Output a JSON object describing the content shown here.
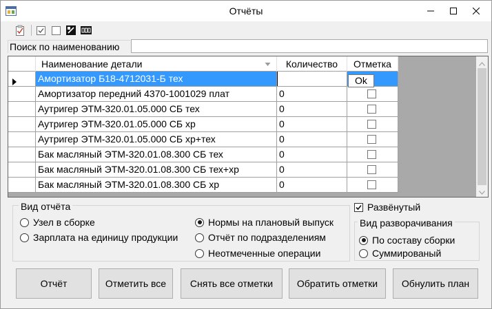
{
  "window": {
    "title": "Отчёты"
  },
  "search": {
    "label": "Поиск по наименованию",
    "value": ""
  },
  "grid": {
    "columns": [
      "Наименование детали",
      "Количество",
      "Отметка"
    ],
    "rows": [
      {
        "name": "Амортизатор Б18-4712031-Б тех",
        "qty": "",
        "checked": false,
        "selected": true
      },
      {
        "name": "Амортизатор передний 4370-1001029 плат",
        "qty": "0",
        "checked": false,
        "selected": false
      },
      {
        "name": "Аутригер ЭТМ-320.01.05.000 СБ тех",
        "qty": "0",
        "checked": false,
        "selected": false
      },
      {
        "name": "Аутригер ЭТМ-320.01.05.000 СБ хр",
        "qty": "0",
        "checked": false,
        "selected": false
      },
      {
        "name": "Аутригер ЭТМ-320.01.05.000 СБ хр+тех",
        "qty": "0",
        "checked": false,
        "selected": false
      },
      {
        "name": "Бак масляный ЭТМ-320.01.08.300 СБ тех",
        "qty": "0",
        "checked": false,
        "selected": false
      },
      {
        "name": "Бак масляный ЭТМ-320.01.08.300 СБ тех+хр",
        "qty": "0",
        "checked": false,
        "selected": false
      },
      {
        "name": "Бак масляный ЭТМ-320.01.08.300 СБ хр",
        "qty": "0",
        "checked": false,
        "selected": false
      }
    ],
    "ok_popup": "Ok"
  },
  "report_type": {
    "label": "Вид отчёта",
    "options": [
      "Узел в сборке",
      "Зарплата на единицу продукции",
      "Нормы на плановый выпуск",
      "Отчёт по подразделениям",
      "Неотмеченные операции"
    ],
    "selected": "Нормы на плановый выпуск"
  },
  "expanded": {
    "label": "Развёнутый",
    "checked": true
  },
  "expand_mode": {
    "label": "Вид разворачивания",
    "options": [
      "По составу сборки",
      "Суммированый"
    ],
    "selected": "По составу сборки"
  },
  "buttons": {
    "report": "Отчёт",
    "mark_all": "Отметить все",
    "unmark_all": "Снять все отметки",
    "invert": "Обратить отметки",
    "reset_plan": "Обнулить план"
  },
  "colors": {
    "selection": "#3399ff",
    "window_bg": "#f0f0f0"
  }
}
